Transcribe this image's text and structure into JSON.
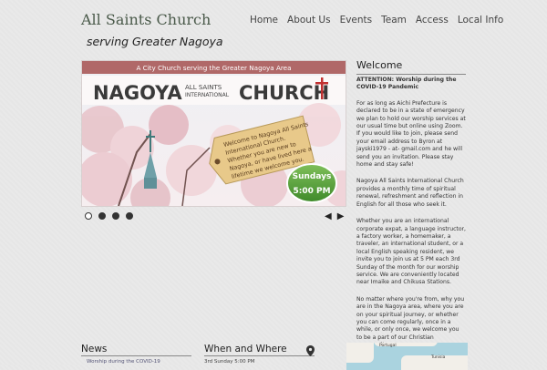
{
  "site": {
    "title": "All Saints Church",
    "tagline": "serving Greater Nagoya"
  },
  "nav": [
    "Home",
    "About Us",
    "Events",
    "Team",
    "Access",
    "Local Info"
  ],
  "slider": {
    "banner": "A City Church serving the Greater Nagoya Area",
    "logo_left": "NAGOYA",
    "logo_mid_1": "ALL SAINTS",
    "logo_mid_2": "INTERNATIONAL",
    "logo_right": "CHURCH",
    "tag_lines": [
      "Welcome to Nagoya All Saints",
      "International Church.",
      "Whether you are new to",
      "Nagoya, or have lived here a",
      "lifetime we welcome you."
    ],
    "badge_top": "Sundays",
    "badge_bottom": "5:00 PM",
    "slide_count": 4,
    "active_slide": 1
  },
  "welcome": {
    "heading": "Welcome",
    "attention": "ATTENTION: Worship during the COVID-19 Pandemic",
    "p1": "For as long as Aichi Prefecture is declared to be in a state of emergency we plan to hold our worship services at our usual time but online using Zoom. If you would like to join, please send your email address to Byron at jayski1979 - at- gmail.com and he will send you an invitation. Please stay home and stay safe!",
    "p2": "Nagoya All Saints International Church provides a monthly time of spiritual renewal, refreshment and reflection in English for all those who seek it.",
    "p3": "Whether you are an international corporate expat, a language instructor, a factory worker, a homemaker, a traveler, an international student, or a local English speaking resident, we invite you to join us at 5 PM each 3rd Sunday of the month for our worship service. We are conveniently located near Imaike and Chikusa Stations.",
    "p4": "No matter where you're from, why you are in the Nagoya area, where you are on your spiritual journey, or whether you can come regularly, once in a while, or only once, we welcome you to be a part of our Christian community."
  },
  "news": {
    "heading": "News",
    "first_item": "Worship during the COVID-19"
  },
  "when": {
    "heading": "When and Where",
    "line1": "3rd Sunday 5:00 PM"
  },
  "map": {
    "labels": [
      "Portugal",
      "Tunisia"
    ]
  }
}
